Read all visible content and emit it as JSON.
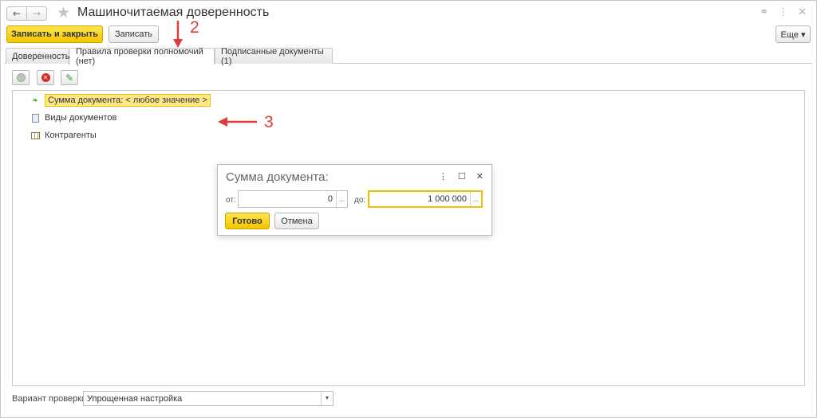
{
  "window": {
    "title": "Машиночитаемая доверенность",
    "back_icon": "←",
    "forward_icon": "→",
    "star_icon": "★",
    "link_icon": "⚭",
    "menu_icon": "⋮",
    "close_icon": "✕"
  },
  "toolbar": {
    "save_close_label": "Записать и закрыть",
    "save_label": "Записать",
    "more_label": "Еще ▾"
  },
  "annotations": {
    "num2": "2",
    "num3": "3"
  },
  "tabs": [
    {
      "label": "Доверенность"
    },
    {
      "label": "Правила проверки полномочий (нет)"
    },
    {
      "label": "Подписанные документы (1)"
    }
  ],
  "tree": {
    "items": [
      {
        "label": "Сумма документа: < любое значение >"
      },
      {
        "label": "Виды документов"
      },
      {
        "label": "Контрагенты"
      }
    ]
  },
  "popup": {
    "title": "Сумма документа:",
    "from_label": "от:",
    "from_value": "0",
    "to_label": "до:",
    "to_value": "1 000 000",
    "ellipsis": "...",
    "ok_label": "Готово",
    "cancel_label": "Отмена",
    "menu_icon": "⋮",
    "maximize_icon": "☐",
    "close_icon": "✕"
  },
  "footer": {
    "variant_label": "Вариант проверки:",
    "variant_value": "Упрощенная настройка",
    "arrow": "▼"
  },
  "colors": {
    "accent": "#f4c500",
    "annotation": "#e03a3a",
    "selection": "#ffe689"
  }
}
